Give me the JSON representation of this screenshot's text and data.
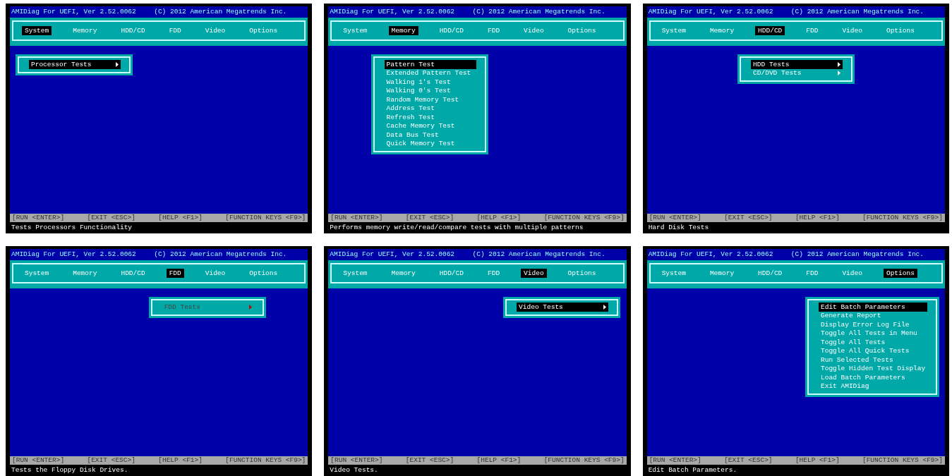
{
  "screens": [
    {
      "title": "AMIDiag For UEFI, Ver 2.52.0062",
      "copyright": "(C) 2012 American Megatrends Inc.",
      "menu": [
        {
          "label": "System",
          "selected": true
        },
        {
          "label": "Memory",
          "selected": false
        },
        {
          "label": "HDD/CD",
          "selected": false
        },
        {
          "label": "FDD",
          "selected": false
        },
        {
          "label": "Video",
          "selected": false
        },
        {
          "label": "Options",
          "selected": false
        }
      ],
      "popup": [
        {
          "label": "Processor Tests",
          "selected": true,
          "submenu": true,
          "disabled": false
        }
      ],
      "keys": [
        "[RUN <ENTER>]",
        "[EXIT <ESC>]",
        "[HELP <F1>]",
        "[FUNCTION KEYS <F9>]"
      ],
      "message": "Tests Processors Functionality"
    },
    {
      "title": "AMIDiag For UEFI, Ver 2.52.0062",
      "copyright": "(C) 2012 American Megatrends Inc.",
      "menu": [
        {
          "label": "System",
          "selected": false
        },
        {
          "label": "Memory",
          "selected": true
        },
        {
          "label": "HDD/CD",
          "selected": false
        },
        {
          "label": "FDD",
          "selected": false
        },
        {
          "label": "Video",
          "selected": false
        },
        {
          "label": "Options",
          "selected": false
        }
      ],
      "popup": [
        {
          "label": "Pattern Test",
          "selected": true,
          "submenu": false,
          "disabled": false
        },
        {
          "label": "Extended Pattern Test",
          "selected": false,
          "submenu": false,
          "disabled": false
        },
        {
          "label": "Walking 1's Test",
          "selected": false,
          "submenu": false,
          "disabled": false
        },
        {
          "label": "Walking 0's Test",
          "selected": false,
          "submenu": false,
          "disabled": false
        },
        {
          "label": "Random Memory Test",
          "selected": false,
          "submenu": false,
          "disabled": false
        },
        {
          "label": "Address Test",
          "selected": false,
          "submenu": false,
          "disabled": false
        },
        {
          "label": "Refresh Test",
          "selected": false,
          "submenu": false,
          "disabled": false
        },
        {
          "label": "Cache Memory Test",
          "selected": false,
          "submenu": false,
          "disabled": false
        },
        {
          "label": "Data Bus Test",
          "selected": false,
          "submenu": false,
          "disabled": false
        },
        {
          "label": "Quick Memory Test",
          "selected": false,
          "submenu": false,
          "disabled": false
        }
      ],
      "keys": [
        "[RUN <ENTER>]",
        "[EXIT <ESC>]",
        "[HELP <F1>]",
        "[FUNCTION KEYS <F9>]"
      ],
      "message": "Performs memory write/read/compare tests with multiple patterns"
    },
    {
      "title": "AMIDiag For UEFI, Ver 2.52.0062",
      "copyright": "(C) 2012 American Megatrends Inc.",
      "menu": [
        {
          "label": "System",
          "selected": false
        },
        {
          "label": "Memory",
          "selected": false
        },
        {
          "label": "HDD/CD",
          "selected": true
        },
        {
          "label": "FDD",
          "selected": false
        },
        {
          "label": "Video",
          "selected": false
        },
        {
          "label": "Options",
          "selected": false
        }
      ],
      "popup": [
        {
          "label": "HDD Tests",
          "selected": true,
          "submenu": true,
          "disabled": false
        },
        {
          "label": "CD/DVD Tests",
          "selected": false,
          "submenu": true,
          "disabled": false
        }
      ],
      "keys": [
        "[RUN <ENTER>]",
        "[EXIT <ESC>]",
        "[HELP <F1>]",
        "[FUNCTION KEYS <F9>]"
      ],
      "message": "Hard Disk Tests"
    },
    {
      "title": "AMIDiag For UEFI, Ver 2.52.0062",
      "copyright": "(C) 2012 American Megatrends Inc.",
      "menu": [
        {
          "label": "System",
          "selected": false
        },
        {
          "label": "Memory",
          "selected": false
        },
        {
          "label": "HDD/CD",
          "selected": false
        },
        {
          "label": "FDD",
          "selected": true
        },
        {
          "label": "Video",
          "selected": false
        },
        {
          "label": "Options",
          "selected": false
        }
      ],
      "popup": [
        {
          "label": "FDD Tests",
          "selected": false,
          "submenu": true,
          "disabled": true
        }
      ],
      "keys": [
        "[RUN <ENTER>]",
        "[EXIT <ESC>]",
        "[HELP <F1>]",
        "[FUNCTION KEYS <F9>]"
      ],
      "message": "Tests the Floppy Disk Drives."
    },
    {
      "title": "AMIDiag For UEFI, Ver 2.52.0062",
      "copyright": "(C) 2012 American Megatrends Inc.",
      "menu": [
        {
          "label": "System",
          "selected": false
        },
        {
          "label": "Memory",
          "selected": false
        },
        {
          "label": "HDD/CD",
          "selected": false
        },
        {
          "label": "FDD",
          "selected": false
        },
        {
          "label": "Video",
          "selected": true
        },
        {
          "label": "Options",
          "selected": false
        }
      ],
      "popup": [
        {
          "label": "Video Tests",
          "selected": true,
          "submenu": true,
          "disabled": false
        }
      ],
      "keys": [
        "[RUN <ENTER>]",
        "[EXIT <ESC>]",
        "[HELP <F1>]",
        "[FUNCTION KEYS <F9>]"
      ],
      "message": "Video Tests."
    },
    {
      "title": "AMIDiag For UEFI, Ver 2.52.0062",
      "copyright": "(C) 2012 American Megatrends Inc.",
      "menu": [
        {
          "label": "System",
          "selected": false
        },
        {
          "label": "Memory",
          "selected": false
        },
        {
          "label": "HDD/CD",
          "selected": false
        },
        {
          "label": "FDD",
          "selected": false
        },
        {
          "label": "Video",
          "selected": false
        },
        {
          "label": "Options",
          "selected": true
        }
      ],
      "popup": [
        {
          "label": "Edit Batch Parameters",
          "selected": true,
          "submenu": false,
          "disabled": false
        },
        {
          "label": "Generate Report",
          "selected": false,
          "submenu": false,
          "disabled": false
        },
        {
          "label": "Display Error Log File",
          "selected": false,
          "submenu": false,
          "disabled": false
        },
        {
          "label": "Toggle All Tests in Menu",
          "selected": false,
          "submenu": false,
          "disabled": false
        },
        {
          "label": "Toggle All Tests",
          "selected": false,
          "submenu": false,
          "disabled": false
        },
        {
          "label": "Toggle All Quick Tests",
          "selected": false,
          "submenu": false,
          "disabled": false
        },
        {
          "label": "Run Selected Tests",
          "selected": false,
          "submenu": false,
          "disabled": false
        },
        {
          "label": "Toggle Hidden Test Display",
          "selected": false,
          "submenu": false,
          "disabled": false
        },
        {
          "label": "Load Batch Parameters",
          "selected": false,
          "submenu": false,
          "disabled": false
        },
        {
          "label": "Exit AMIDiag",
          "selected": false,
          "submenu": false,
          "disabled": false
        }
      ],
      "keys": [
        "[RUN <ENTER>]",
        "[EXIT <ESC>]",
        "[HELP <F1>]",
        "[FUNCTION KEYS <F9>]"
      ],
      "message": "Edit Batch Parameters."
    }
  ]
}
